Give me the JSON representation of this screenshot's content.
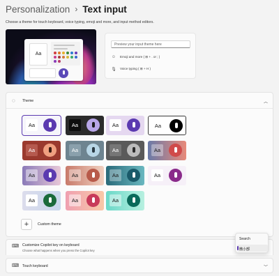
{
  "breadcrumb": {
    "parent": "Personalization",
    "separator": "›",
    "current": "Text input"
  },
  "subtitle": "Choose a theme for touch keyboard, voice typing, emoji and more, and input method editors.",
  "preview": {
    "key_label": "Aa",
    "dot_colors": [
      "#d23b3b",
      "#e07a2a",
      "#e6b22a",
      "#3a8a3a",
      "#2a7ad0",
      "#6a3ab8",
      "#c83a8a",
      "#a83a3a",
      "#d27a3a",
      "#d6b83a",
      "#3aa86a",
      "#3a6ad0",
      "#8a3ab8",
      "#b83a6a"
    ]
  },
  "card": {
    "input_placeholder": "Preview your input theme here",
    "rows": [
      {
        "icon": "emoji-icon",
        "glyph": "☺",
        "label": "Emoji and more ( ⊞ + . or ; )"
      },
      {
        "icon": "microphone-icon",
        "glyph": "🎙",
        "label": "Voice typing ( ⊞ + H )"
      }
    ]
  },
  "theme": {
    "title": "Theme",
    "key_label": "Aa",
    "tiles": [
      {
        "bg": "#f6f5fb",
        "aa_bg": "#ffffff",
        "aa_fg": "#1b1b1b",
        "mic_bg": "#5b3ab0",
        "mic_fg": "#ffffff",
        "selected": true
      },
      {
        "bg": "#2b2b2b",
        "aa_bg": "#0e0e0e",
        "aa_fg": "#ffffff",
        "mic_bg": "#b8a6e8",
        "mic_fg": "#1b1b1b"
      },
      {
        "bg": "#e5d8f0",
        "aa_bg": "#ffffff",
        "aa_fg": "#1b1b1b",
        "mic_bg": "#5b3ab0",
        "mic_fg": "#ffffff"
      },
      {
        "bg": "#ffffff",
        "aa_bg": "#ffffff",
        "aa_fg": "#1b1b1b",
        "mic_bg": "#000000",
        "mic_fg": "#ffffff",
        "bordered": true
      },
      {
        "bg": "#9a3a2e",
        "aa_bg": "#b55a4e",
        "aa_fg": "#ffffff",
        "mic_bg": "#f0a080",
        "mic_fg": "#3a1a10"
      },
      {
        "bg": "#6e8490",
        "aa_bg": "#8aa0ac",
        "aa_fg": "#ffffff",
        "mic_bg": "#b8d6e6",
        "mic_fg": "#2a3a44"
      },
      {
        "bg": "#5a5a5a",
        "aa_bg": "#767676",
        "aa_fg": "#ffffff",
        "mic_bg": "#bcbcbc",
        "mic_fg": "#2a2a2a"
      },
      {
        "bg": "linear-gradient(90deg,#6a7aa8,#e88a7a)",
        "aa_bg": "rgba(255,255,255,0.35)",
        "aa_fg": "#1b1b1b",
        "mic_bg": "#d04a4a",
        "mic_fg": "#ffffff"
      },
      {
        "bg": "linear-gradient(90deg,#8a7ab8,#e8c8d8)",
        "aa_bg": "rgba(255,255,255,0.45)",
        "aa_fg": "#1b1b1b",
        "mic_bg": "#5b3ab0",
        "mic_fg": "#ffffff"
      },
      {
        "bg": "linear-gradient(90deg,#c87a6a,#f0d0c0)",
        "aa_bg": "rgba(255,255,255,0.4)",
        "aa_fg": "#1b1b1b",
        "mic_bg": "#b85a4a",
        "mic_fg": "#ffffff"
      },
      {
        "bg": "linear-gradient(90deg,#2a6a7a,#6ab8c0)",
        "aa_bg": "rgba(255,255,255,0.35)",
        "aa_fg": "#1b1b1b",
        "mic_bg": "#1a5a6a",
        "mic_fg": "#ffffff"
      },
      {
        "bg": "#f6f0f8",
        "aa_bg": "#ffffff",
        "aa_fg": "#1b1b1b",
        "mic_bg": "#8a2a8a",
        "mic_fg": "#ffffff"
      },
      {
        "bg": "linear-gradient(90deg,#dcdcec,#c8d8ec)",
        "aa_bg": "#ffffff",
        "aa_fg": "#1b1b1b",
        "mic_bg": "#1a6a3a",
        "mic_fg": "#ffffff"
      },
      {
        "bg": "linear-gradient(90deg,#f0a0b0,#f8c8a8)",
        "aa_bg": "rgba(255,255,255,0.5)",
        "aa_fg": "#1b1b1b",
        "mic_bg": "#c83a5a",
        "mic_fg": "#ffffff"
      },
      {
        "bg": "linear-gradient(90deg,#6ad8c8,#b8f0e0)",
        "aa_bg": "rgba(255,255,255,0.45)",
        "aa_fg": "#1b1b1b",
        "mic_bg": "#0a6a5a",
        "mic_fg": "#ffffff"
      }
    ],
    "custom_label": "Custom theme",
    "custom_plus": "+"
  },
  "copilot": {
    "title": "Customize Copilot key on keyboard",
    "subtitle": "Choose what happens when you press the Copilot key"
  },
  "touch": {
    "title": "Touch keyboard"
  },
  "dropdown": {
    "items": [
      "Search",
      "微小部"
    ],
    "selected_index": 1
  }
}
